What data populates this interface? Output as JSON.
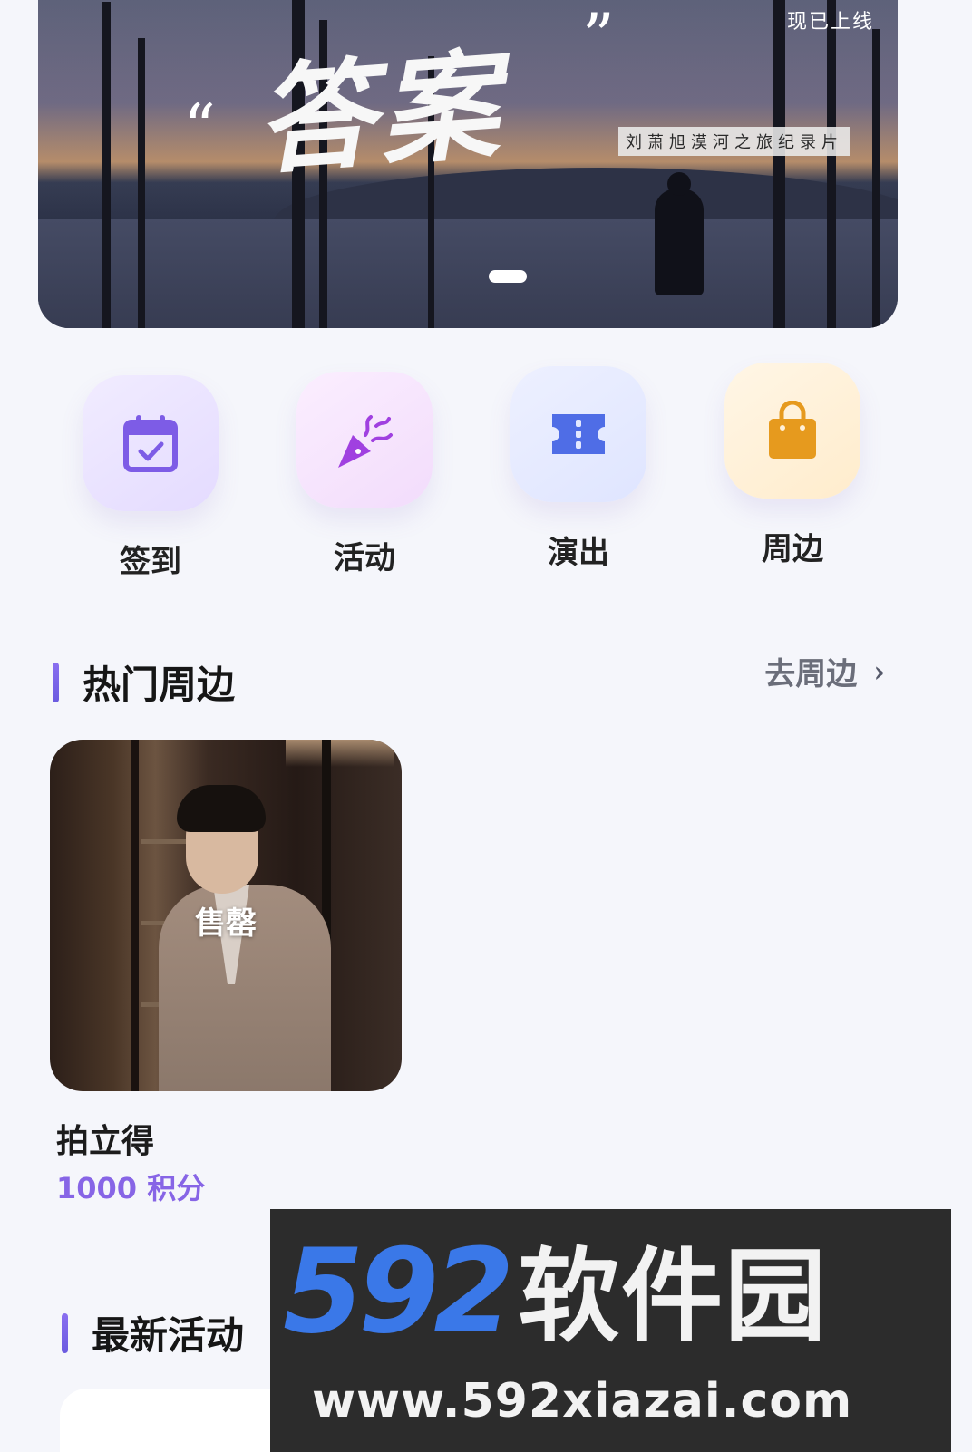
{
  "banner": {
    "title": "答案",
    "quote_left": "“",
    "quote_right": "”",
    "subtitle": "刘萧旭漠河之旅纪录片",
    "tag": "现已上线"
  },
  "quick_nav": [
    {
      "label": "签到",
      "icon": "calendar-check-icon",
      "bg": "#ece6ff",
      "color": "#7d5ce6"
    },
    {
      "label": "活动",
      "icon": "party-popper-icon",
      "bg": "#f7e4fb",
      "color": "#a040e0"
    },
    {
      "label": "演出",
      "icon": "ticket-icon",
      "bg": "#e3e8ff",
      "color": "#4f6de6"
    },
    {
      "label": "周边",
      "icon": "shopping-bag-icon",
      "bg": "#fff0d8",
      "color": "#e69a1e"
    }
  ],
  "hot_merch": {
    "title": "热门周边",
    "link_label": "去周边",
    "items": [
      {
        "name": "拍立得",
        "price": "1000 积分",
        "status": "售罄"
      }
    ]
  },
  "latest_activity": {
    "title": "最新活动"
  },
  "watermark": {
    "number": "592",
    "name": "软件园",
    "url": "www.592xiazai.com"
  },
  "colors": {
    "accent": "#8765e6",
    "background": "#f5f6fb"
  }
}
